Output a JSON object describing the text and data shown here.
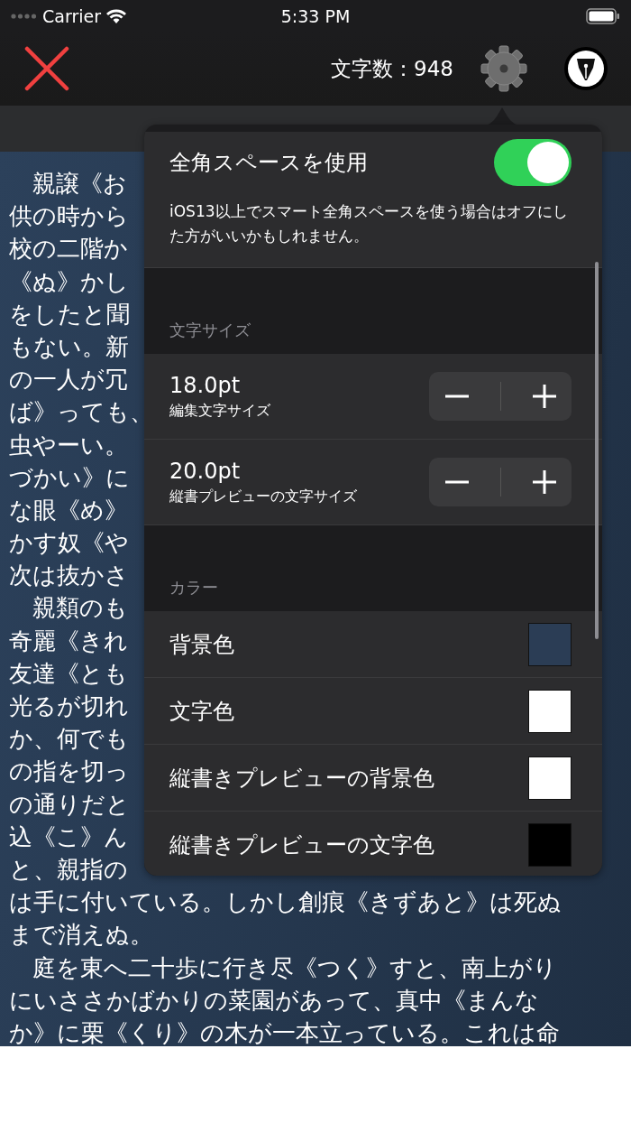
{
  "status_bar": {
    "carrier": "Carrier",
    "time": "5:33 PM"
  },
  "nav": {
    "char_count": "文字数：948"
  },
  "editor": {
    "lines": [
      "　親譲《お",
      "供の時から",
      "校の二階か",
      "《ぬ》かし",
      "をしたと聞",
      "もない。新",
      "の一人が冗",
      "ば》っても、",
      "虫やーい。",
      "づかい》に",
      "な眼《め》",
      "かす奴《や",
      "次は抜かさ",
      "　親類のも",
      "奇麗《きれ",
      "友達《とも",
      "光るが切れ",
      "か、何でも",
      "の指を切っ",
      "の通りだと",
      "込《こ》ん",
      "と、親指の",
      "は手に付いている。しかし創痕《きずあと》は死ぬ",
      "まで消えぬ。",
      "　庭を東へ二十歩に行き尽《つく》すと、南上がり",
      "にいささかばかりの菜園があって、真中《まんな",
      "か》に栗《くり》の木が一本立っている。これは命"
    ]
  },
  "popover": {
    "rows": [
      {
        "kind": "toggle",
        "label": "全角スペースを使用",
        "on": true,
        "note": "iOS13以上でスマート全角スペースを使う場合はオフにした方がいいかもしれません。"
      },
      {
        "kind": "header",
        "label": "文字サイズ"
      },
      {
        "kind": "stepper",
        "value": "18.0pt",
        "label": "編集文字サイズ"
      },
      {
        "kind": "stepper",
        "value": "20.0pt",
        "label": "縦書プレビューの文字サイズ"
      },
      {
        "kind": "header",
        "label": "カラー"
      },
      {
        "kind": "color",
        "label": "背景色",
        "color": "#2b3d55"
      },
      {
        "kind": "color",
        "label": "文字色",
        "color": "#ffffff"
      },
      {
        "kind": "color",
        "label": "縦書きプレビューの背景色",
        "color": "#ffffff"
      },
      {
        "kind": "color",
        "label": "縦書きプレビューの文字色",
        "color": "#000000"
      }
    ]
  }
}
